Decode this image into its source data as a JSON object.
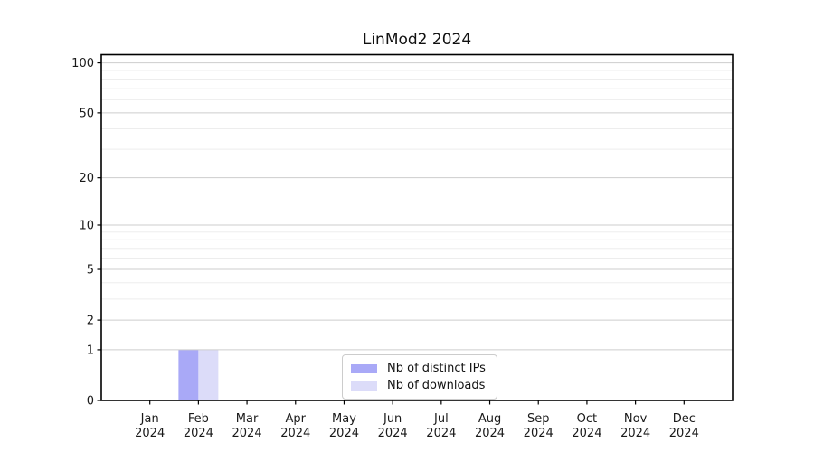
{
  "title": "LinMod2 2024",
  "chart_data": {
    "type": "bar",
    "title": "LinMod2 2024",
    "categories": [
      "Jan 2024",
      "Feb 2024",
      "Mar 2024",
      "Apr 2024",
      "May 2024",
      "Jun 2024",
      "Jul 2024",
      "Aug 2024",
      "Sep 2024",
      "Oct 2024",
      "Nov 2024",
      "Dec 2024"
    ],
    "series": [
      {
        "name": "Nb of distinct IPs",
        "color": "#a9a9f7",
        "values": [
          0,
          1,
          0,
          0,
          0,
          0,
          0,
          0,
          0,
          0,
          0,
          0
        ]
      },
      {
        "name": "Nb of downloads",
        "color": "#dcdcf9",
        "values": [
          0,
          1,
          0,
          0,
          0,
          0,
          0,
          0,
          0,
          0,
          0,
          0
        ]
      }
    ],
    "y_scale": "log10(1+x)",
    "y_major_ticks": [
      0,
      1,
      2,
      5,
      10,
      20,
      50,
      100
    ],
    "y_minor_ticks": [
      3,
      4,
      6,
      7,
      8,
      9,
      30,
      40,
      60,
      70,
      80,
      90
    ],
    "ylim": [
      0,
      112
    ],
    "grid": true,
    "legend_position": "bottom-center"
  },
  "colors": {
    "major_grid": "#cdcdcd",
    "minor_grid": "#ededed",
    "axis": "#000000",
    "text": "#1a1a1a",
    "background": "#ffffff",
    "legend_border": "#cccccc"
  }
}
